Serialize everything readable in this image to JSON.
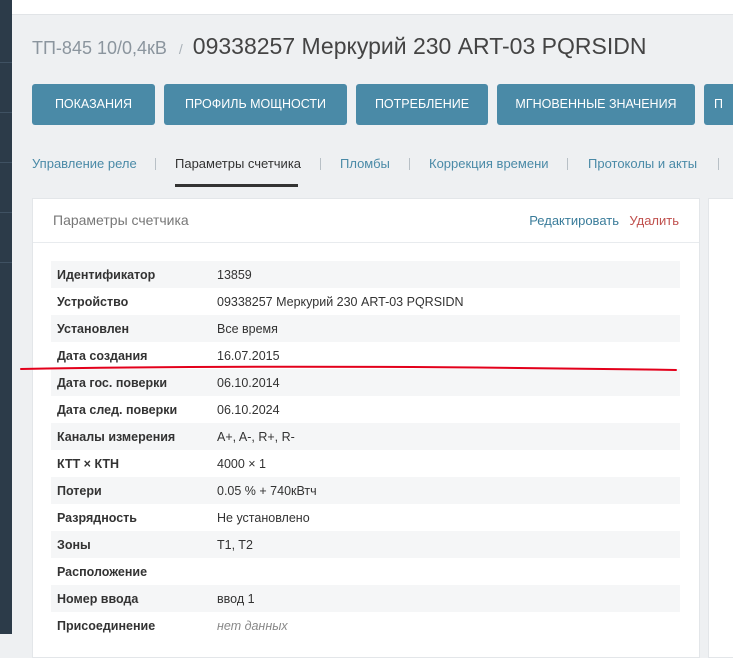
{
  "header": {
    "breadcrumb": "ТП-845 10/0,4кВ",
    "separator": "/",
    "title": "09338257 Меркурий 230 ART-03 PQRSIDN"
  },
  "buttons": [
    {
      "label": "ПОКАЗАНИЯ"
    },
    {
      "label": "ПРОФИЛЬ МОЩНОСТИ"
    },
    {
      "label": "ПОТРЕБЛЕНИЕ"
    },
    {
      "label": "МГНОВЕННЫЕ ЗНАЧЕНИЯ"
    },
    {
      "label": "П"
    }
  ],
  "tabs": [
    {
      "label": "Управление реле",
      "active": false
    },
    {
      "label": "Параметры счетчика",
      "active": true
    },
    {
      "label": "Пломбы",
      "active": false
    },
    {
      "label": "Коррекция времени",
      "active": false
    },
    {
      "label": "Протоколы и акты",
      "active": false
    }
  ],
  "card": {
    "title": "Параметры счетчика",
    "edit_label": "Редактировать",
    "delete_label": "Удалить"
  },
  "params": [
    {
      "key": "Идентификатор",
      "value": "13859"
    },
    {
      "key": "Устройство",
      "value": "09338257 Меркурий 230 ART-03 PQRSIDN"
    },
    {
      "key": "Установлен",
      "value": "Все время"
    },
    {
      "key": "Дата создания",
      "value": "16.07.2015"
    },
    {
      "key": "Дата гос. поверки",
      "value": "06.10.2014"
    },
    {
      "key": "Дата след. поверки",
      "value": "06.10.2024"
    },
    {
      "key": "Каналы измерения",
      "value": "A+, A-, R+, R-"
    },
    {
      "key": "КТТ × КТН",
      "value": "4000 × 1"
    },
    {
      "key": "Потери",
      "value": "0.05 % + 740кВтч"
    },
    {
      "key": "Разрядность",
      "value": "Не установлено"
    },
    {
      "key": "Зоны",
      "value": "T1, T2"
    },
    {
      "key": "Расположение",
      "value": ""
    },
    {
      "key": "Номер ввода",
      "value": "ввод 1"
    },
    {
      "key": "Присоединение",
      "value": "нет данных"
    }
  ],
  "colors": {
    "button_bg": "#4a8aa7",
    "link": "#4a8aa7",
    "delete": "#c0504d",
    "annotation_line": "#e3001b"
  }
}
